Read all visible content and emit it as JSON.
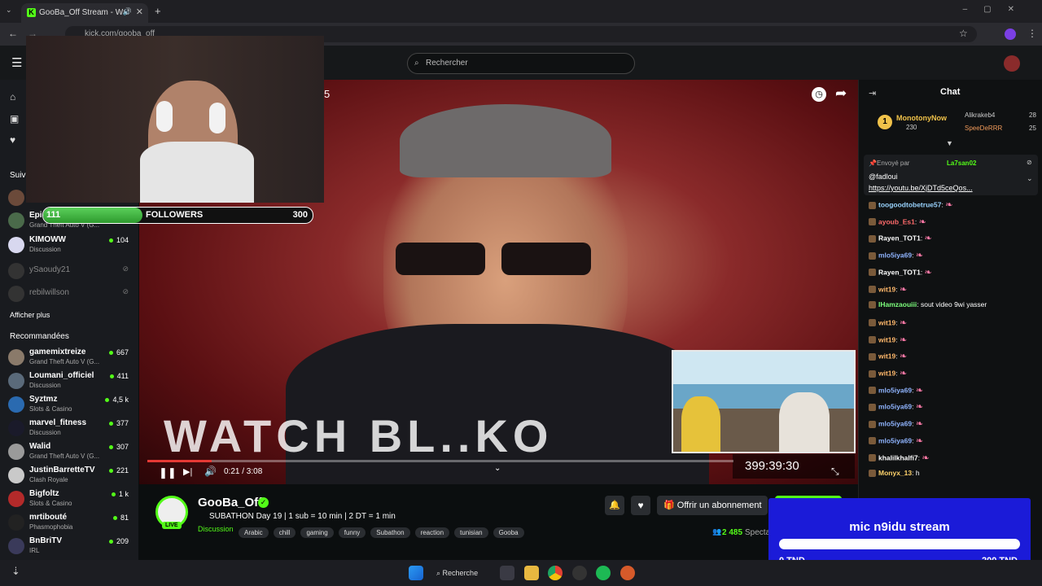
{
  "browser": {
    "tab_title": "GooBa_Off Stream - Watch",
    "tab_favicon": "K",
    "url": "kick.com/gooba_off"
  },
  "header": {
    "search_placeholder": "Rechercher"
  },
  "sidebar": {
    "followed_title": "Suiv",
    "followed": [
      {
        "name": "",
        "category": "",
        "viewers": ""
      },
      {
        "name": "Epi",
        "category": "Grand Theft Auto V (G...",
        "viewers": ""
      },
      {
        "name": "KIMOWW",
        "category": "Discussion",
        "viewers": "104"
      },
      {
        "name": "ySaoudy21",
        "category": "",
        "viewers": "",
        "offline": true
      },
      {
        "name": "rebilwillson",
        "category": "",
        "viewers": "",
        "offline": true
      }
    ],
    "show_more": "Afficher plus",
    "recommended_title": "Recommandées",
    "recommended": [
      {
        "name": "gamemixtreize",
        "category": "Grand Theft Auto V (G...",
        "viewers": "667"
      },
      {
        "name": "Loumani_officiel",
        "category": "Discussion",
        "viewers": "411"
      },
      {
        "name": "Syztmz",
        "category": "Slots & Casino",
        "viewers": "4,5 k"
      },
      {
        "name": "marvel_fitness",
        "category": "Discussion",
        "viewers": "377"
      },
      {
        "name": "Walid",
        "category": "Grand Theft Auto V (G...",
        "viewers": "307"
      },
      {
        "name": "JustinBarretteTV",
        "category": "Clash Royale",
        "viewers": "221"
      },
      {
        "name": "Bigfoltz",
        "category": "Slots & Casino",
        "viewers": "1 k"
      },
      {
        "name": "mrtibouté",
        "category": "Phasmophobia",
        "viewers": "81"
      },
      {
        "name": "BnBriTV",
        "category": "IRL",
        "viewers": "209"
      }
    ]
  },
  "overlay": {
    "followers_current": "111",
    "followers_label": "FOLLOWERS",
    "followers_goal": "300",
    "followers_progress": 0.37,
    "corner_number": "5",
    "video_caption": "WATCH BL..KO"
  },
  "player": {
    "time_label": "0:21 / 3:08",
    "progress": 0.11,
    "subathon_timer": "399:39:30"
  },
  "stream": {
    "channel": "GooBa_Off",
    "live_badge": "LIVE",
    "title": "SUBATHON Day 19 | 1 sub = 10 min | 2 DT = 1 min",
    "category": "Discussion",
    "tags": [
      "Arabic",
      "chill",
      "gaming",
      "funny",
      "Subathon",
      "reaction",
      "tunisian",
      "Gooba"
    ],
    "subscribe_label": "Offrir un abonnement",
    "viewers": "2 485",
    "viewers_suffix": "Specta"
  },
  "chat": {
    "title": "Chat",
    "top_gifters": [
      {
        "rank": "1",
        "name": "MonotonyNow",
        "amount": "230"
      },
      {
        "name": "Alikrakeb4",
        "amount": "28"
      },
      {
        "name": "SpeeDeRRR",
        "amount": "25"
      }
    ],
    "pinned_sender_prefix": "Envoyé par",
    "pinned_sender": "La7san02",
    "pinned_mention": "@fadloui",
    "pinned_link": "https://youtu.be/XjDTd5ceQos...",
    "messages": [
      {
        "user": "toogoodtobetrue57",
        "color": "#9ad4ff",
        "text": ""
      },
      {
        "user": "ayoub_Es1",
        "color": "#ff6b6b",
        "text": ""
      },
      {
        "user": "Rayen_TOT1",
        "color": "#ffffff",
        "text": ""
      },
      {
        "user": "mlo5iya69",
        "color": "#8fb4ff",
        "text": ""
      },
      {
        "user": "Rayen_TOT1",
        "color": "#ffffff",
        "text": ""
      },
      {
        "user": "wit19",
        "color": "#ffb86b",
        "text": ""
      },
      {
        "user": "IHamzaouiii",
        "color": "#7dff7d",
        "text": "sout video 9wi yasser"
      },
      {
        "user": "wit19",
        "color": "#ffb86b",
        "text": ""
      },
      {
        "user": "wit19",
        "color": "#ffb86b",
        "text": ""
      },
      {
        "user": "wit19",
        "color": "#ffb86b",
        "text": ""
      },
      {
        "user": "wit19",
        "color": "#ffb86b",
        "text": ""
      },
      {
        "user": "mlo5iya69",
        "color": "#8fb4ff",
        "text": ""
      },
      {
        "user": "mlo5iya69",
        "color": "#8fb4ff",
        "text": ""
      },
      {
        "user": "mlo5iya69",
        "color": "#8fb4ff",
        "text": ""
      },
      {
        "user": "mlo5iya69",
        "color": "#8fb4ff",
        "text": ""
      },
      {
        "user": "khalilkhalfi7",
        "color": "#ffffff",
        "text": ""
      },
      {
        "user": "Monyx_13",
        "color": "#ffd36b",
        "text": "h"
      }
    ]
  },
  "mic_goal": {
    "title": "mic n9idu stream",
    "min": "0 TND",
    "max": "200 TND",
    "progress": 0.0
  },
  "taskbar": {
    "search_label": "Recherche"
  },
  "colors": {
    "kick_green": "#53fc18",
    "mic_blue": "#1b1bd8",
    "timer_red": "#e53935"
  }
}
